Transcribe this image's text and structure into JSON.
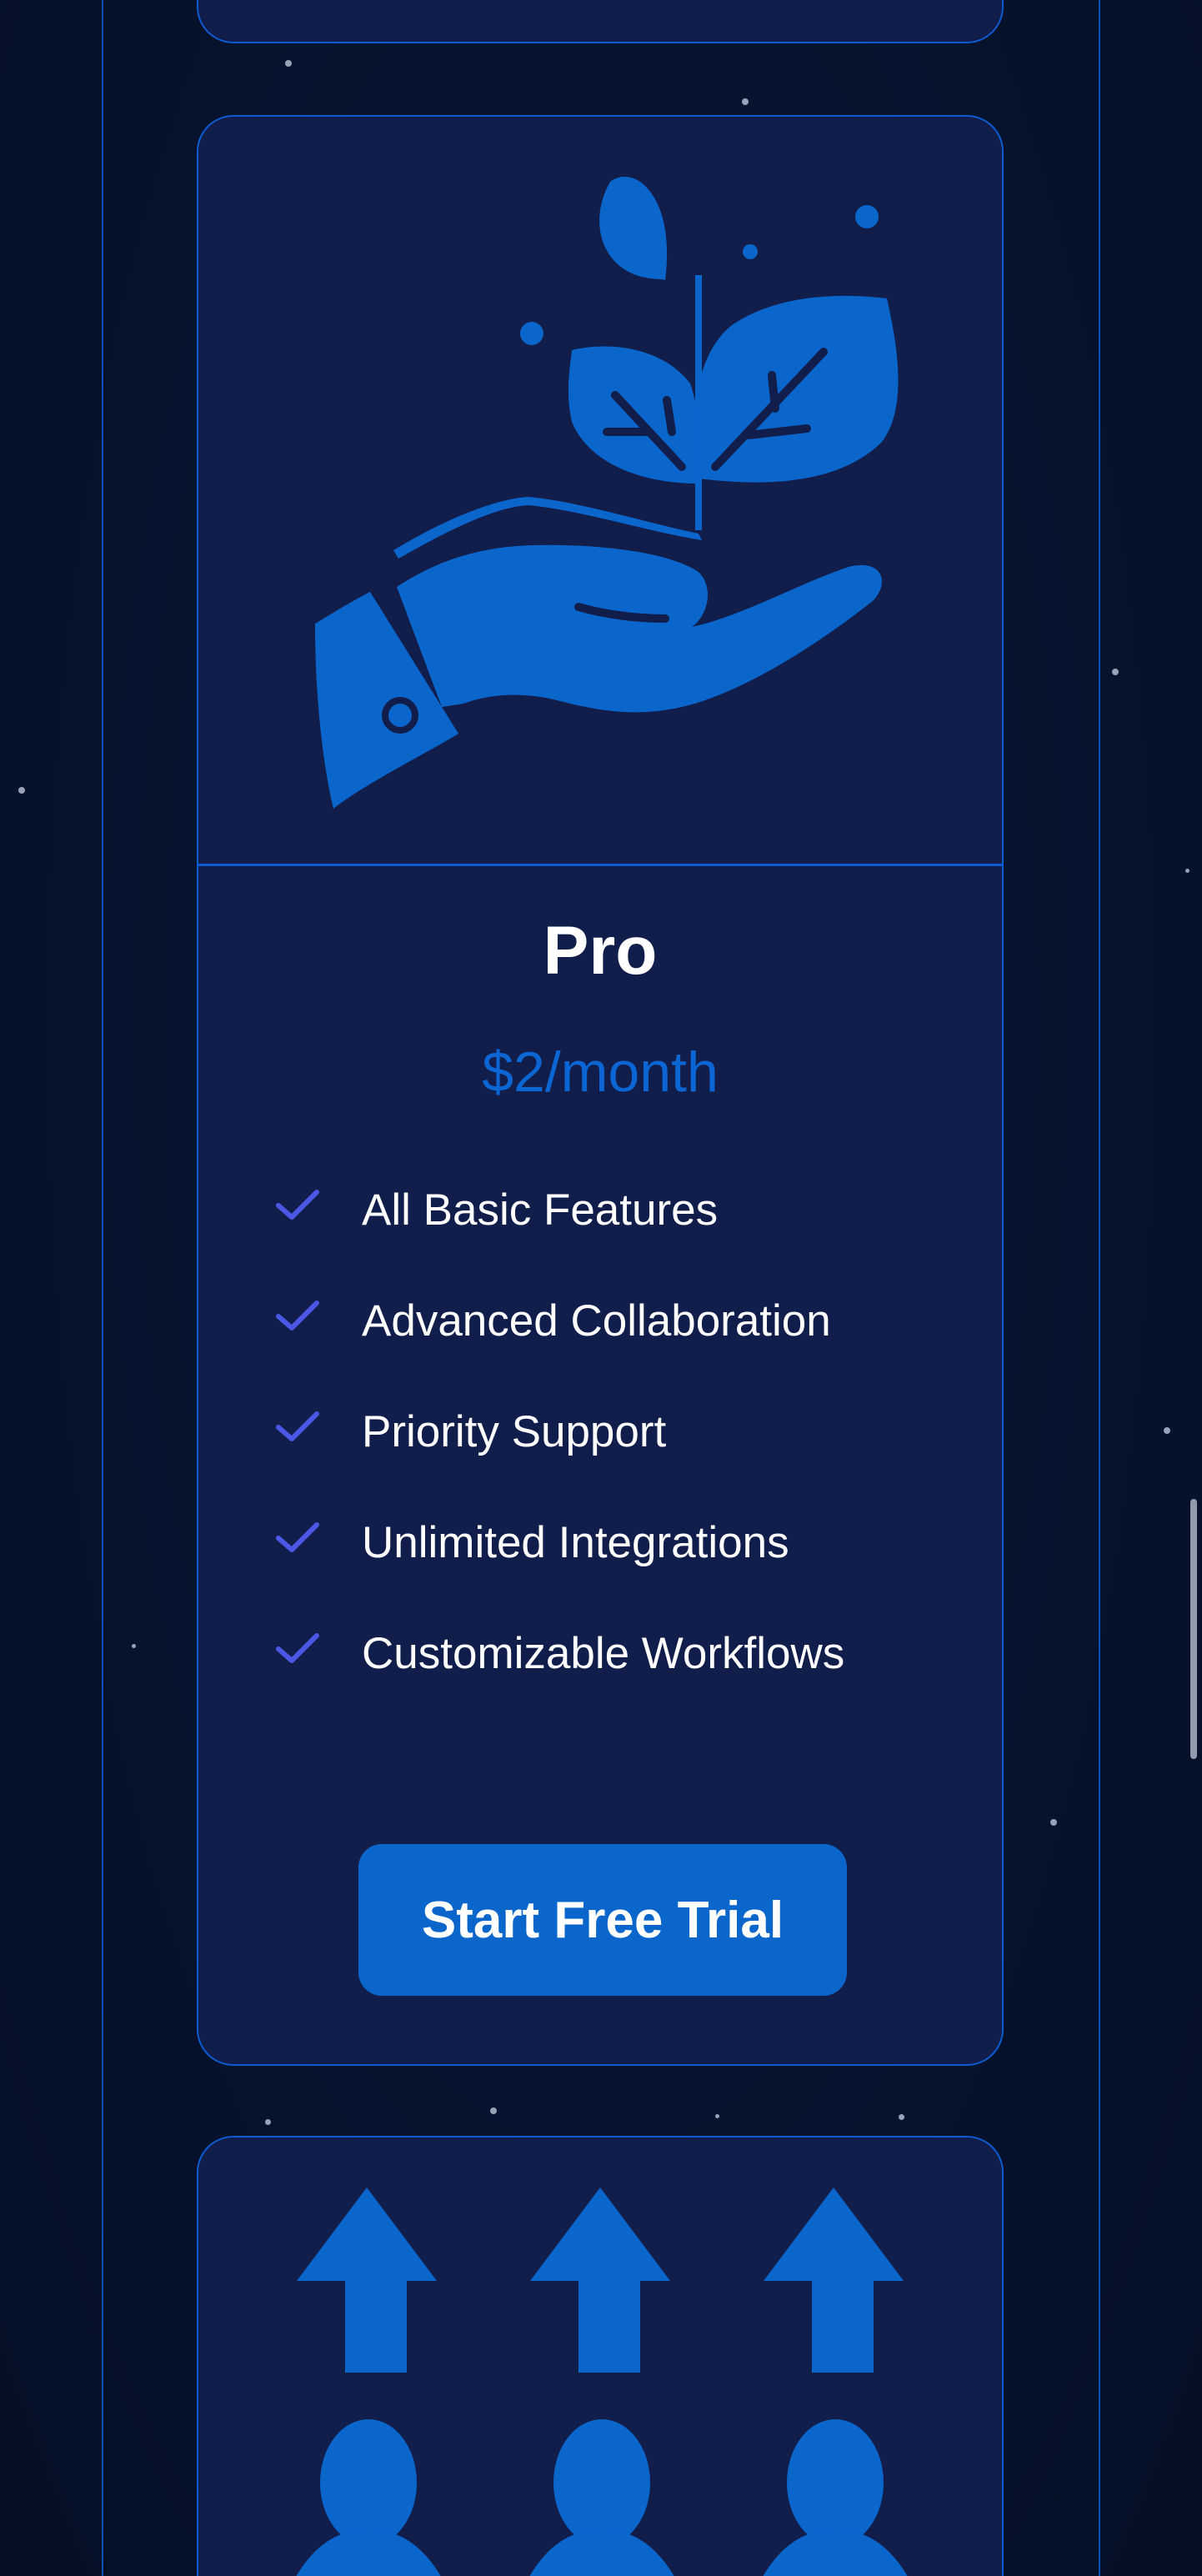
{
  "pro_plan": {
    "illustration_icon": "hand-with-sprout-icon",
    "title": "Pro",
    "price": "$2/month",
    "features": [
      "All Basic Features",
      "Advanced Collaboration",
      "Priority Support",
      "Unlimited Integrations",
      "Customizable Workflows"
    ],
    "cta_label": "Start Free Trial"
  },
  "next_plan": {
    "illustration_icon": "team-growth-arrows-icon"
  },
  "colors": {
    "background": "#06122b",
    "card": "#111d4a",
    "accent": "#0b66d4",
    "border": "#0c5bd1",
    "check": "#4b58e6",
    "text": "#ffffff"
  }
}
